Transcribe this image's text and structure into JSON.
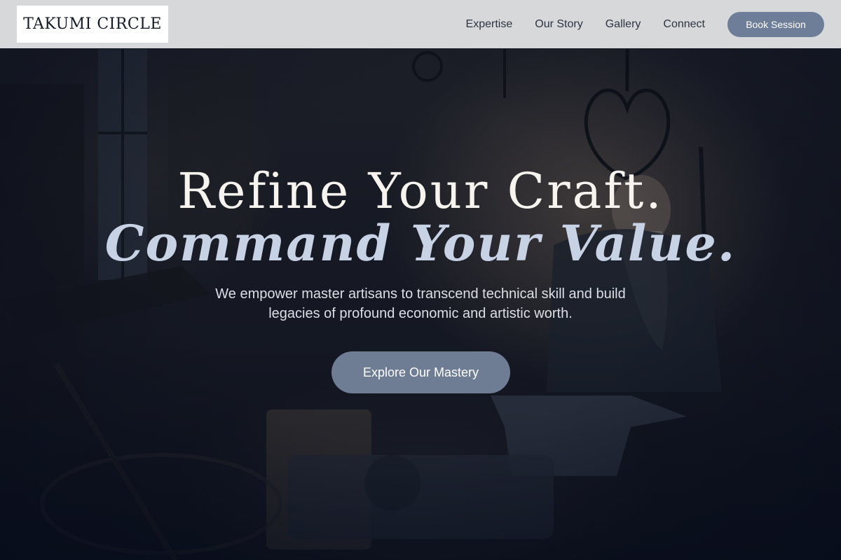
{
  "header": {
    "logo": "TAKUMI CIRCLE",
    "nav": [
      {
        "label": "Expertise"
      },
      {
        "label": "Our Story"
      },
      {
        "label": "Gallery"
      },
      {
        "label": "Connect"
      }
    ],
    "cta_label": "Book Session"
  },
  "hero": {
    "headline_line1": "Refine Your Craft.",
    "headline_line2": "Command Your Value.",
    "subtext": "We empower master artisans to transcend technical skill and build legacies of profound economic and artistic worth.",
    "cta_label": "Explore Our Mastery",
    "background_image": "blacksmith-workshop-photo"
  },
  "colors": {
    "header_bg": "#e2e4e6",
    "accent": "#6e7e98",
    "headline": "#f7f3ee",
    "headline_accent": "#c7d2e5",
    "overlay": "#0c1426"
  }
}
